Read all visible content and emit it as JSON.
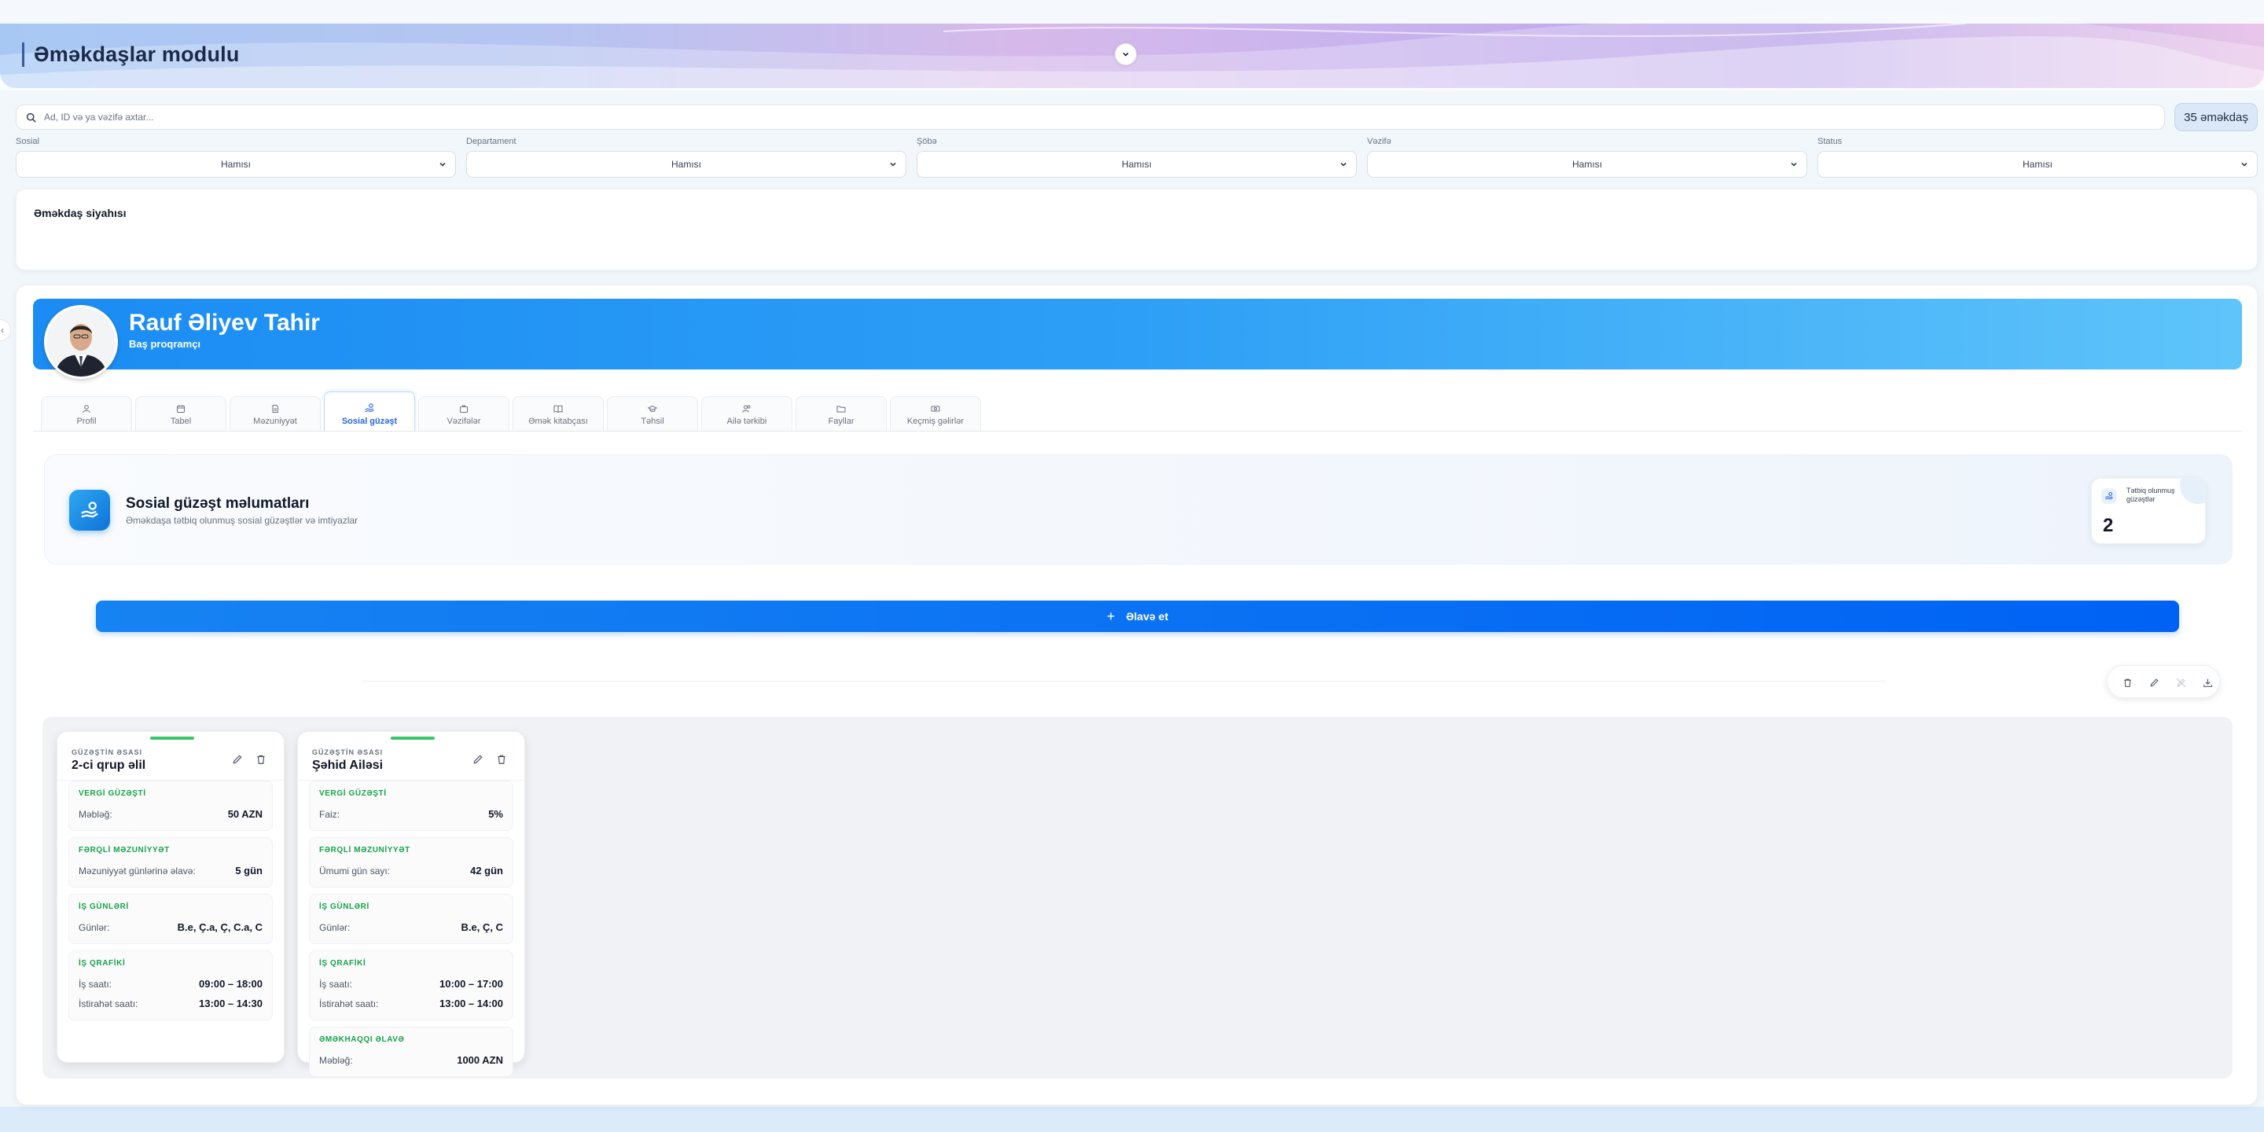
{
  "app": {
    "title": "Əməkdaşlar modulu"
  },
  "search": {
    "placeholder": "Ad, ID və ya vəzifə axtar...",
    "count_label": "35 əməkdaş"
  },
  "filters": [
    {
      "label": "Sosial",
      "value": "Hamısı"
    },
    {
      "label": "Departament",
      "value": "Hamısı"
    },
    {
      "label": "Şöbə",
      "value": "Hamısı"
    },
    {
      "label": "Vəzifə",
      "value": "Hamısı"
    },
    {
      "label": "Status",
      "value": "Hamısı"
    }
  ],
  "list": {
    "title": "Əməkdaş siyahısı"
  },
  "employee": {
    "name": "Rauf Əliyev Tahir",
    "role": "Baş proqramçı"
  },
  "tabs": [
    {
      "label": "Profil",
      "icon": "user-icon"
    },
    {
      "label": "Tabel",
      "icon": "calendar-icon"
    },
    {
      "label": "Məzuniyyət",
      "icon": "document-icon"
    },
    {
      "label": "Sosial güzəşt",
      "icon": "hand-coins-icon",
      "active": true
    },
    {
      "label": "Vəzifələr",
      "icon": "briefcase-icon"
    },
    {
      "label": "Əmək kitabçası",
      "icon": "book-icon"
    },
    {
      "label": "Təhsil",
      "icon": "graduation-cap-icon"
    },
    {
      "label": "Ailə tərkibi",
      "icon": "users-icon"
    },
    {
      "label": "Fayllar",
      "icon": "folder-icon"
    },
    {
      "label": "Keçmiş gəlirlər",
      "icon": "money-icon"
    }
  ],
  "social": {
    "title": "Sosial güzəşt məlumatları",
    "subtitle": "Əməkdaşa tətbiq olunmuş sosial güzəştlər və imtiyazlar",
    "stat_label": "Tətbiq olunmuş güzəştlər",
    "stat_value": "2",
    "add_label": "Əlavə et"
  },
  "benefits": [
    {
      "basis_label": "GÜZƏŞTİN ƏSASI",
      "name": "2-ci qrup əlil",
      "sections": [
        {
          "title": "VERGİ GÜZƏŞTİ",
          "rows": [
            {
              "k": "Məbləğ:",
              "v": "50 AZN"
            }
          ]
        },
        {
          "title": "FƏRQLİ MƏZUNİYYƏT",
          "rows": [
            {
              "k": "Məzuniyyət günlərinə əlavə:",
              "v": "5 gün"
            }
          ]
        },
        {
          "title": "İŞ GÜNLƏRİ",
          "rows": [
            {
              "k": "Günlər:",
              "v": "B.e, Ç.a, Ç, C.a, C"
            }
          ]
        },
        {
          "title": "İŞ QRAFİKİ",
          "rows": [
            {
              "k": "İş saatı:",
              "v": "09:00 – 18:00"
            },
            {
              "k": "İstirahət saatı:",
              "v": "13:00 – 14:30"
            }
          ]
        }
      ]
    },
    {
      "basis_label": "GÜZƏŞTİN ƏSASI",
      "name": "Şəhid Ailəsi",
      "sections": [
        {
          "title": "VERGİ GÜZƏŞTİ",
          "rows": [
            {
              "k": "Faiz:",
              "v": "5%"
            }
          ]
        },
        {
          "title": "FƏRQLİ MƏZUNİYYƏT",
          "rows": [
            {
              "k": "Ümumi gün sayı:",
              "v": "42 gün"
            }
          ]
        },
        {
          "title": "İŞ GÜNLƏRİ",
          "rows": [
            {
              "k": "Günlər:",
              "v": "B.e, Ç, C"
            }
          ]
        },
        {
          "title": "İŞ QRAFİKİ",
          "rows": [
            {
              "k": "İş saatı:",
              "v": "10:00 – 17:00"
            },
            {
              "k": "İstirahət saatı:",
              "v": "13:00 – 14:00"
            }
          ]
        },
        {
          "title": "ƏMƏKHAQQI ƏLAVƏ",
          "rows": [
            {
              "k": "Məbləğ:",
              "v": "1000 AZN"
            }
          ]
        }
      ]
    }
  ],
  "colors": {
    "accent": "#0062f4",
    "banner": "#2d9ff6",
    "success": "#16a34a"
  }
}
